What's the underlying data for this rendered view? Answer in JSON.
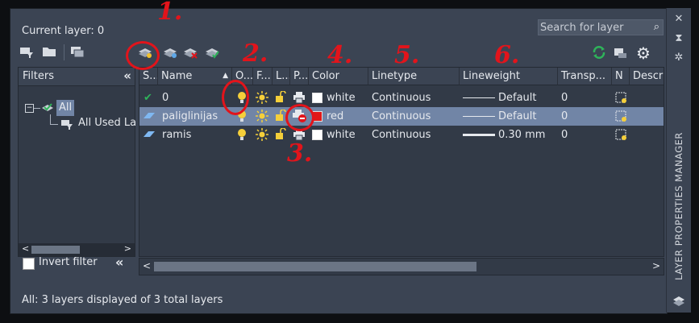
{
  "panel": {
    "current_layer_label": "Current layer: 0",
    "search_placeholder": "Search for layer",
    "vertical_title": "LAYER PROPERTIES MANAGER",
    "status_text": "All: 3 layers displayed of 3 total layers"
  },
  "filters": {
    "header": "Filters",
    "tree": [
      {
        "label": "All"
      },
      {
        "label": "All Used La"
      }
    ],
    "invert_filter": "Invert filter"
  },
  "columns": [
    "S...",
    "Name",
    "O...",
    "F...",
    "L...",
    "P...",
    "Color",
    "Linetype",
    "Lineweight",
    "Transp...",
    "N",
    "Descri"
  ],
  "layers": [
    {
      "status": "current",
      "name": "0",
      "color_name": "white",
      "color_hex": "#ffffff",
      "linetype": "Continuous",
      "lineweight": "Default",
      "transparency": "0"
    },
    {
      "status": "normal",
      "name": "paliglinijas",
      "color_name": "red",
      "color_hex": "#e01818",
      "linetype": "Continuous",
      "lineweight": "Default",
      "transparency": "0"
    },
    {
      "status": "normal",
      "name": "ramis",
      "color_name": "white",
      "color_hex": "#ffffff",
      "linetype": "Continuous",
      "lineweight": "0.30 mm",
      "transparency": "0"
    }
  ],
  "annotations": {
    "n1": "1.",
    "n2": "2.",
    "n3": "3.",
    "n4": "4.",
    "n5": "5.",
    "n6": "6."
  },
  "colors": {
    "panel_bg": "#3b4453",
    "grid_bg": "#323a47",
    "selection": "#7185a6",
    "annotation_red": "#e2141b",
    "accent_green": "#2fb35a"
  }
}
